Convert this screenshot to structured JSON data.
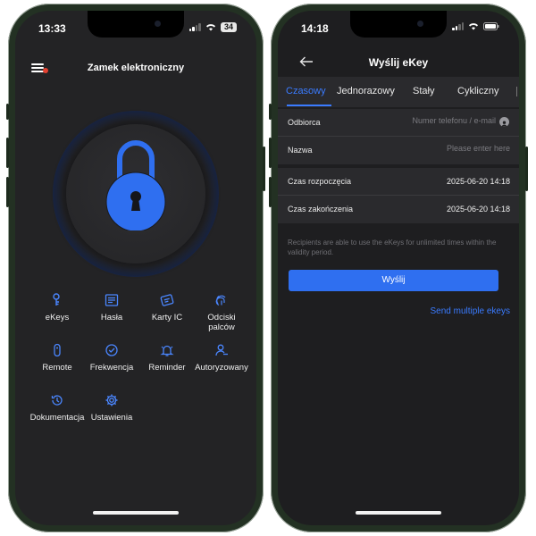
{
  "left_phone": {
    "status": {
      "time": "13:33",
      "battery": "34"
    },
    "header": {
      "title": "Zamek elektroniczny",
      "menu_icon": "hamburger-menu-icon",
      "notification_dot_color": "#e34030"
    },
    "lock": {
      "icon": "padlock-icon",
      "color": "#2f6ff0"
    },
    "menu_items": [
      {
        "label": "eKeys",
        "icon": "key-person-icon"
      },
      {
        "label": "Hasła",
        "icon": "password-list-icon"
      },
      {
        "label": "Karty IC",
        "icon": "ic-card-icon"
      },
      {
        "label": "Odciski palców",
        "icon": "fingerprint-icon"
      },
      {
        "label": "Remote",
        "icon": "remote-icon"
      },
      {
        "label": "Frekwencja",
        "icon": "attendance-check-icon"
      },
      {
        "label": "Reminder",
        "icon": "bell-icon"
      },
      {
        "label": "Autoryzowany",
        "icon": "authorized-user-icon"
      },
      {
        "label": "Dokumentacja",
        "icon": "history-icon"
      },
      {
        "label": "Ustawienia",
        "icon": "gear-icon"
      }
    ]
  },
  "right_phone": {
    "status": {
      "time": "14:18"
    },
    "header": {
      "title": "Wyślij eKey",
      "back_icon": "back-arrow-icon"
    },
    "tabs": [
      {
        "label": "Czasowy",
        "active": true
      },
      {
        "label": "Jednorazowy",
        "active": false
      },
      {
        "label": "Stały",
        "active": false
      },
      {
        "label": "Cykliczny",
        "active": false
      }
    ],
    "form": {
      "recipient": {
        "label": "Odbiorca",
        "placeholder": "Numer telefonu / e-mail",
        "value": ""
      },
      "name": {
        "label": "Nazwa",
        "placeholder": "Please enter here",
        "value": ""
      },
      "start": {
        "label": "Czas rozpoczęcia",
        "value": "2025-06-20 14:18"
      },
      "end": {
        "label": "Czas zakończenia",
        "value": "2025-06-20 14:18"
      }
    },
    "note": "Recipients are able to use the eKeys for unlimited times within the validity period.",
    "send_button": "Wyślij",
    "multi_link": "Send multiple ekeys",
    "accent_color": "#3a7bff"
  }
}
